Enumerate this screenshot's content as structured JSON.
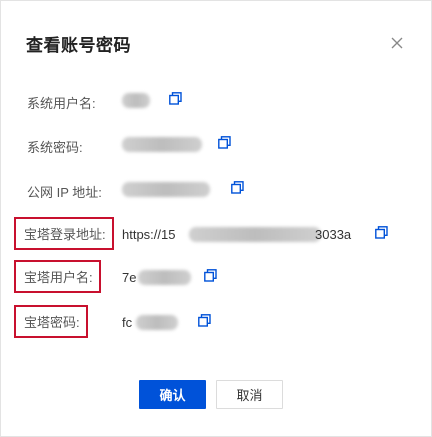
{
  "dialog": {
    "title": "查看账号密码",
    "fields": [
      {
        "label": "系统用户名:",
        "value_visible": "",
        "highlighted": false
      },
      {
        "label": "系统密码:",
        "value_visible": "",
        "highlighted": false
      },
      {
        "label": "公网 IP 地址:",
        "value_visible": "",
        "highlighted": false
      },
      {
        "label": "宝塔登录地址:",
        "value_visible": "https://15",
        "value_suffix": "3033a",
        "highlighted": true
      },
      {
        "label": "宝塔用户名:",
        "value_visible": "7e",
        "highlighted": true
      },
      {
        "label": "宝塔密码:",
        "value_visible": "fc",
        "highlighted": true
      }
    ],
    "buttons": {
      "confirm": "确认",
      "cancel": "取消"
    }
  },
  "colors": {
    "accent": "#0052d9",
    "highlight_border": "#c8102e",
    "copy_icon": "#0052d9"
  }
}
